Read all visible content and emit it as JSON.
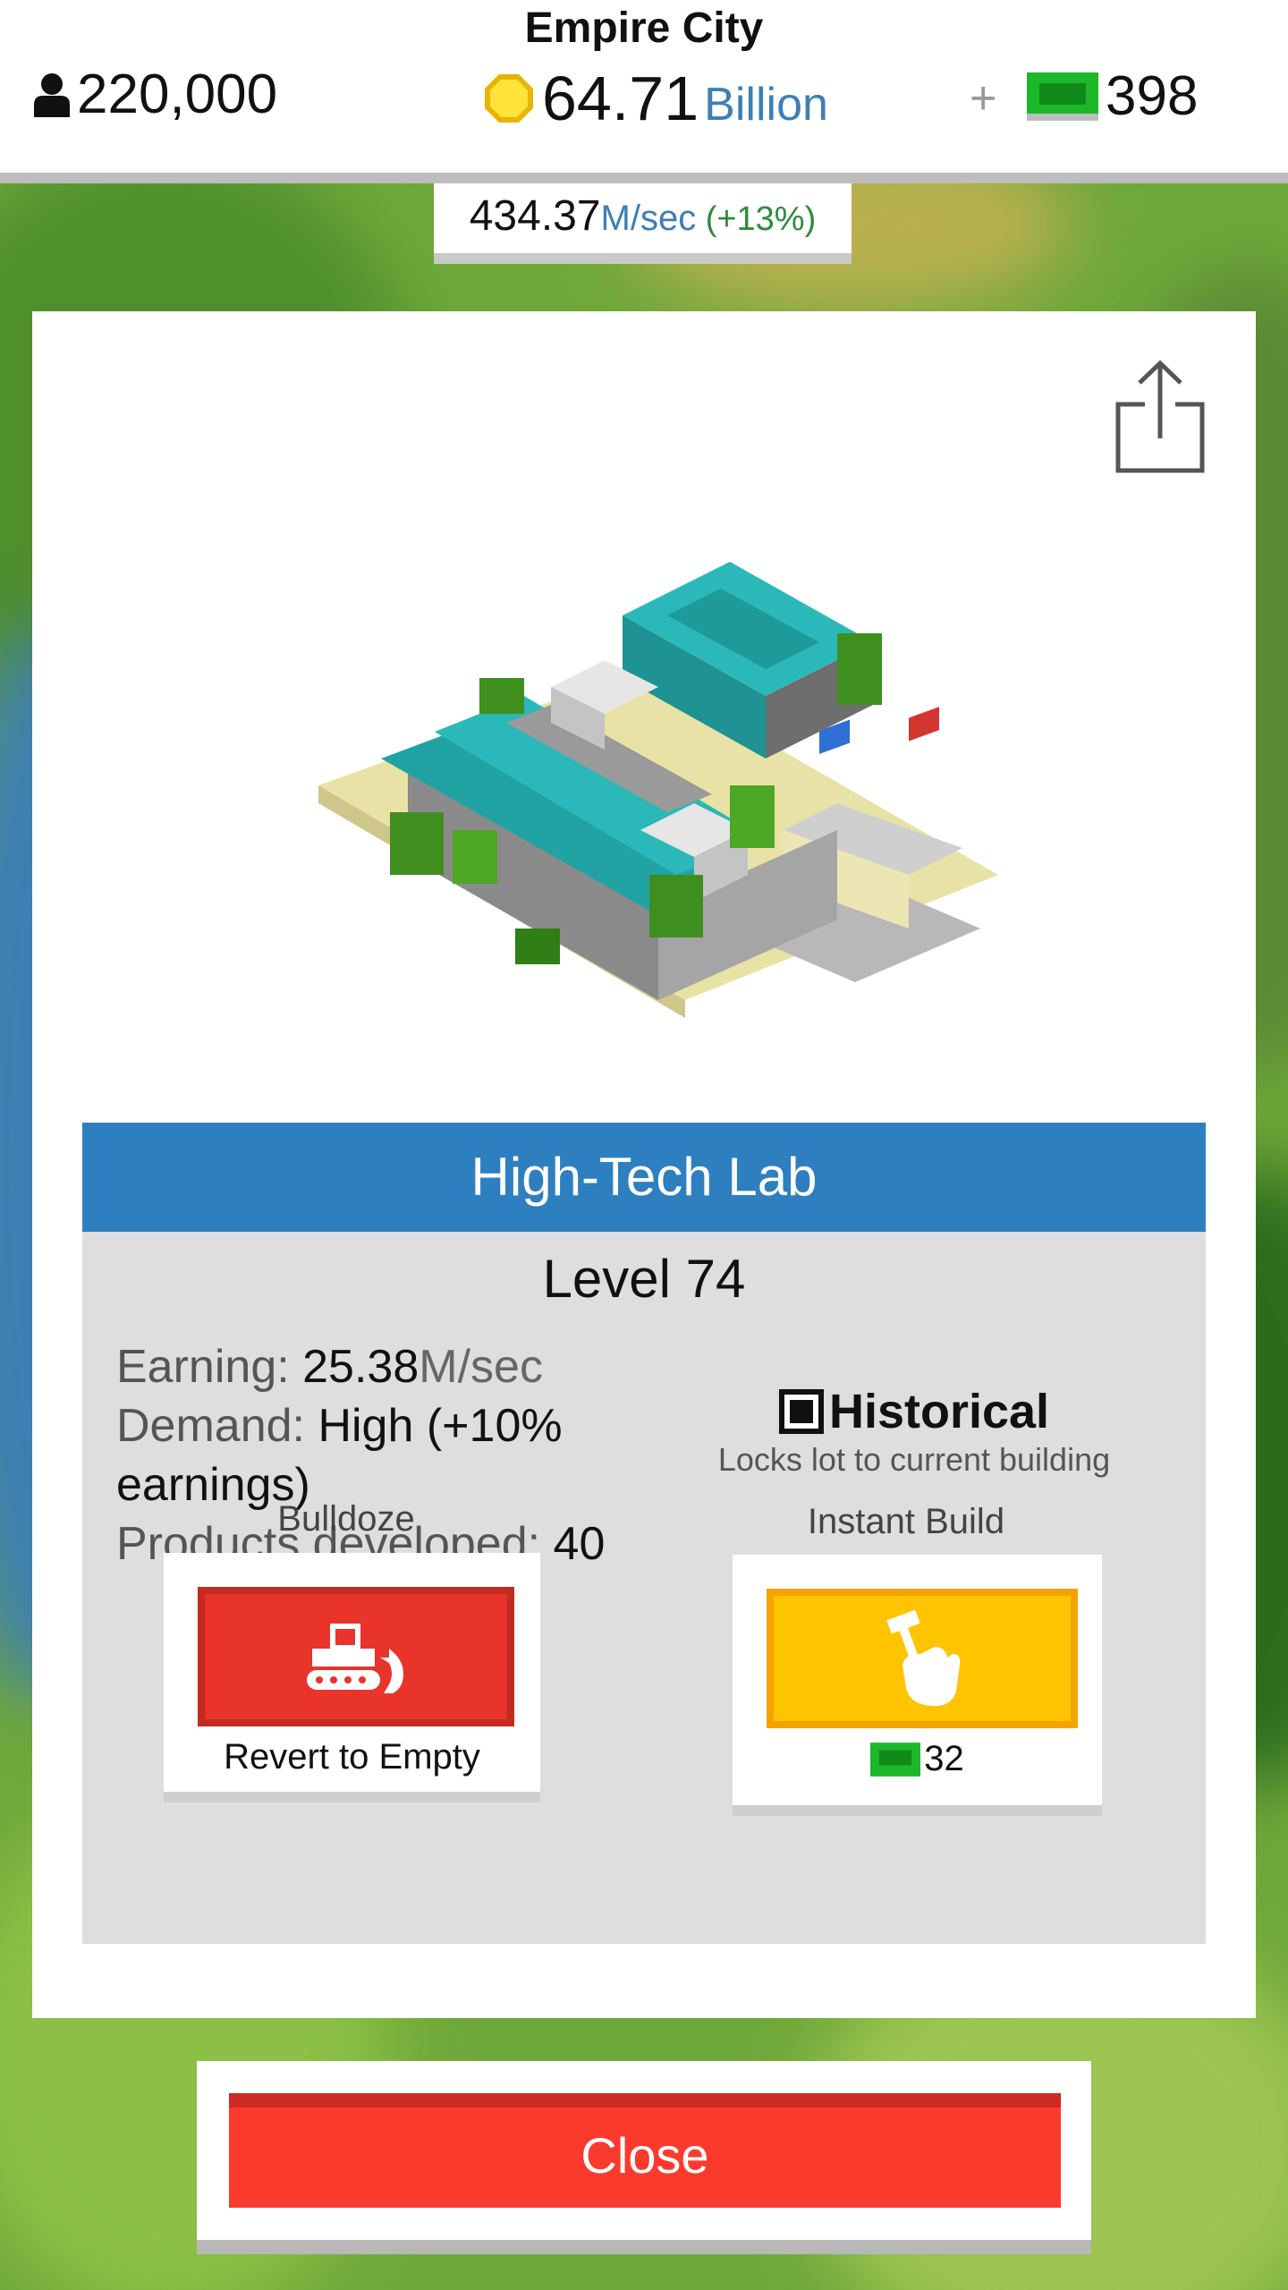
{
  "hud": {
    "city_name": "Empire City",
    "population": "220,000",
    "cash_amount": "64.71",
    "cash_unit": "Billion",
    "bucks": "398",
    "rate": "434.37",
    "rate_unit": "M/sec",
    "rate_bonus": "(+13%)"
  },
  "building": {
    "name": "High-Tech Lab",
    "level_text": "Level 74",
    "earning_label": "Earning: ",
    "earning_value": "25.38",
    "earning_unit": "M/sec",
    "demand_label": "Demand: ",
    "demand_value": "High (+10% earnings)",
    "products_label": "Products developed: ",
    "products_value": "40"
  },
  "historical": {
    "label": "Historical",
    "description": "Locks lot to current building",
    "checked": true
  },
  "actions": {
    "bulldoze_label": "Bulldoze",
    "bulldoze_sub": "Revert to Empty",
    "instant_label": "Instant Build",
    "instant_cost": "32"
  },
  "close_label": "Close",
  "colors": {
    "accent_blue": "#2e7fc0",
    "bulldoze_red": "#e8342a",
    "instant_yellow": "#ffc400",
    "bucks_green": "#1db82a",
    "close_red": "#fb3a2e"
  },
  "icons": [
    "person-icon",
    "coin-icon",
    "plus-icon",
    "bill-icon",
    "share-icon",
    "checkbox-icon",
    "bulldozer-icon",
    "hand-hammer-icon"
  ]
}
